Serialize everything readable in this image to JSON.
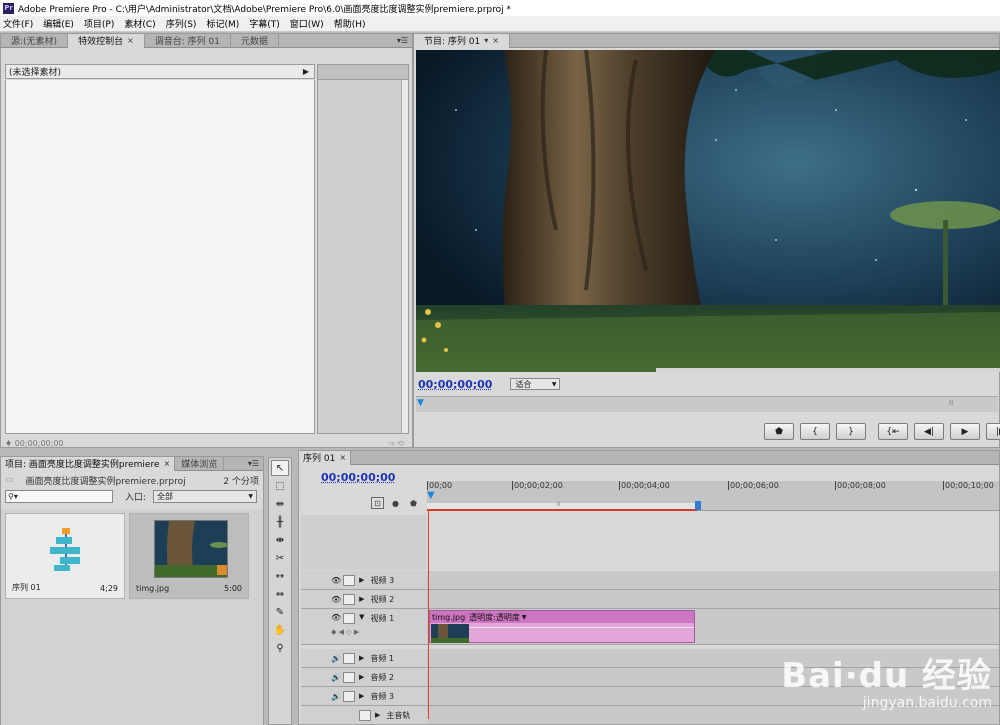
{
  "window": {
    "app_icon": "Pr",
    "title": "Adobe Premiere Pro - C:\\用户\\Administrator\\文档\\Adobe\\Premiere Pro\\6.0\\画面亮度比度调整实例premiere.prproj *"
  },
  "menu": [
    "文件(F)",
    "编辑(E)",
    "项目(P)",
    "素材(C)",
    "序列(S)",
    "标记(M)",
    "字幕(T)",
    "窗口(W)",
    "帮助(H)"
  ],
  "top_left_panel": {
    "tabs": [
      "源:(无素材)",
      "特效控制台",
      "调音台: 序列 01",
      "元数据"
    ],
    "active_tab": "特效控制台",
    "header_text": "(未选择素材)",
    "footer_timecode": "00;00;00;00"
  },
  "program_monitor": {
    "tab_label": "节目: 序列 01",
    "timecode": "00;00;00;00",
    "fit_option": "适合",
    "transport_buttons": [
      "marker-icon",
      "in-point-icon",
      "out-point-icon",
      "go-to-in-icon",
      "step-back-icon",
      "play-icon",
      "step-forward-icon"
    ]
  },
  "project_panel": {
    "tabs": [
      "项目: 画面亮度比度调整实例premiere",
      "媒体浏览"
    ],
    "project_file": "画面亮度比度调整实例premiere.prproj",
    "item_count": "2 个分项",
    "in_label": "入口:",
    "in_option": "全部",
    "items": [
      {
        "name": "序列 01",
        "duration": "4;29",
        "icon": "sequence-icon"
      },
      {
        "name": "timg.jpg",
        "duration": "5:00",
        "icon": "image-thumbnail"
      }
    ]
  },
  "tools": [
    "selection-tool-icon",
    "track-select-tool-icon",
    "ripple-edit-tool-icon",
    "rolling-edit-tool-icon",
    "rate-stretch-tool-icon",
    "razor-tool-icon",
    "slip-tool-icon",
    "slide-tool-icon",
    "pen-tool-icon",
    "hand-tool-icon",
    "zoom-tool-icon"
  ],
  "timeline": {
    "tab_label": "序列 01",
    "timecode": "00;00;00;00",
    "ruler_ticks": [
      "00;00",
      "00;00;02;00",
      "00;00;04;00",
      "00;00;06;00",
      "00;00;08;00",
      "00;00;10;00"
    ],
    "video_tracks": [
      "视频 3",
      "视频 2",
      "视频 1"
    ],
    "audio_tracks": [
      "音频 1",
      "音频 2",
      "音频 3"
    ],
    "master_track": "主音轨",
    "clip": {
      "name": "timg.jpg",
      "effect": "透明度:透明度"
    }
  },
  "watermark": {
    "logo": "Bai·du 经验",
    "url": "jingyan.baidu.com"
  }
}
